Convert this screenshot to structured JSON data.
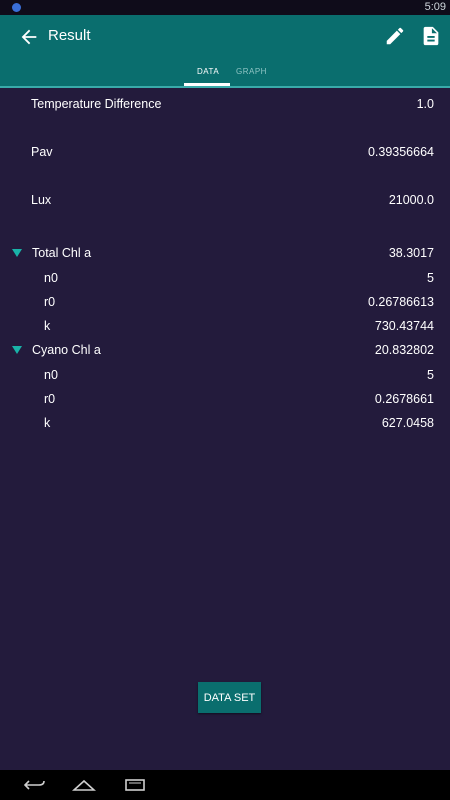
{
  "status": {
    "time": "5:09"
  },
  "header": {
    "title": "Result"
  },
  "tabs": [
    {
      "label": "DATA"
    },
    {
      "label": "GRAPH"
    }
  ],
  "rows": [
    {
      "label": "Temperature Difference",
      "value": "1.0"
    },
    {
      "label": "Pav",
      "value": "0.39356664"
    },
    {
      "label": "Lux",
      "value": "21000.0"
    }
  ],
  "groups": [
    {
      "label": "Total Chl a",
      "value": "38.3017",
      "items": [
        {
          "label": "n0",
          "value": "5"
        },
        {
          "label": "r0",
          "value": "0.26786613"
        },
        {
          "label": "k",
          "value": "730.43744"
        }
      ]
    },
    {
      "label": "Cyano Chl a",
      "value": "20.832802",
      "items": [
        {
          "label": "n0",
          "value": "5"
        },
        {
          "label": "r0",
          "value": "0.2678661"
        },
        {
          "label": "k",
          "value": "627.0458"
        }
      ]
    }
  ],
  "footer": {
    "button_label": "DATA SET"
  },
  "colors": {
    "background": "#231b3c",
    "primary": "#0a6e6e",
    "accent": "#19b3a8"
  },
  "icons": [
    "back-arrow-icon",
    "edit-pencil-icon",
    "document-icon",
    "expand-triangle-icon",
    "nav-back-icon",
    "nav-home-icon",
    "nav-recents-icon"
  ]
}
